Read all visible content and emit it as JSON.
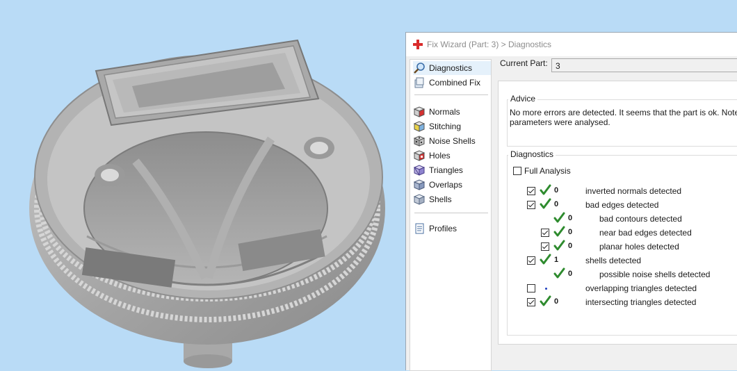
{
  "window": {
    "title": "Fix Wizard (Part: 3) > Diagnostics"
  },
  "nav": {
    "items": [
      {
        "label": "Diagnostics",
        "icon": "magnifier-icon",
        "selected": true
      },
      {
        "label": "Combined Fix",
        "icon": "combined-fix-icon"
      },
      {
        "label": "Normals",
        "icon": "normals-cube-icon"
      },
      {
        "label": "Stitching",
        "icon": "stitching-cube-icon"
      },
      {
        "label": "Noise Shells",
        "icon": "noise-shells-icon"
      },
      {
        "label": "Holes",
        "icon": "holes-cube-icon"
      },
      {
        "label": "Triangles",
        "icon": "triangles-cube-icon"
      },
      {
        "label": "Overlaps",
        "icon": "overlaps-cube-icon"
      },
      {
        "label": "Shells",
        "icon": "shells-cube-icon"
      },
      {
        "label": "Profiles",
        "icon": "profiles-document-icon"
      }
    ]
  },
  "current_part": {
    "label": "Current Part:",
    "value": "3"
  },
  "advice": {
    "label": "Advice",
    "text_line1": "No more errors are detected. It seems that the part is ok. Note",
    "text_line2": "parameters were analysed."
  },
  "diagnostics": {
    "label": "Diagnostics",
    "full_analysis": {
      "label": "Full Analysis",
      "checked": false
    },
    "rows": [
      {
        "checkbox": true,
        "checked": true,
        "status": "ok",
        "count": "0",
        "label": "inverted normals detected",
        "indent": 0
      },
      {
        "checkbox": true,
        "checked": true,
        "status": "ok",
        "count": "0",
        "label": "bad edges detected",
        "indent": 0
      },
      {
        "checkbox": false,
        "checked": false,
        "status": "ok",
        "count": "0",
        "label": "bad contours detected",
        "indent": 1
      },
      {
        "checkbox": true,
        "checked": true,
        "status": "ok",
        "count": "0",
        "label": "near bad edges detected",
        "indent": 1
      },
      {
        "checkbox": true,
        "checked": true,
        "status": "ok",
        "count": "0",
        "label": "planar holes detected",
        "indent": 1
      },
      {
        "checkbox": true,
        "checked": true,
        "status": "ok",
        "count": "1",
        "label": "shells detected",
        "indent": 0
      },
      {
        "checkbox": false,
        "checked": false,
        "status": "ok",
        "count": "0",
        "label": "possible noise shells detected",
        "indent": 1
      },
      {
        "checkbox": true,
        "checked": false,
        "status": "pending",
        "count": "",
        "label": "overlapping triangles detected",
        "indent": 0
      },
      {
        "checkbox": true,
        "checked": true,
        "status": "ok",
        "count": "0",
        "label": "intersecting triangles detected",
        "indent": 0
      }
    ]
  },
  "colors": {
    "viewport_bg": "#b9dbf6",
    "ok_check": "#2e8b2e",
    "pending_dot": "#1f3fbf",
    "app_icon": "#d92b2b"
  }
}
